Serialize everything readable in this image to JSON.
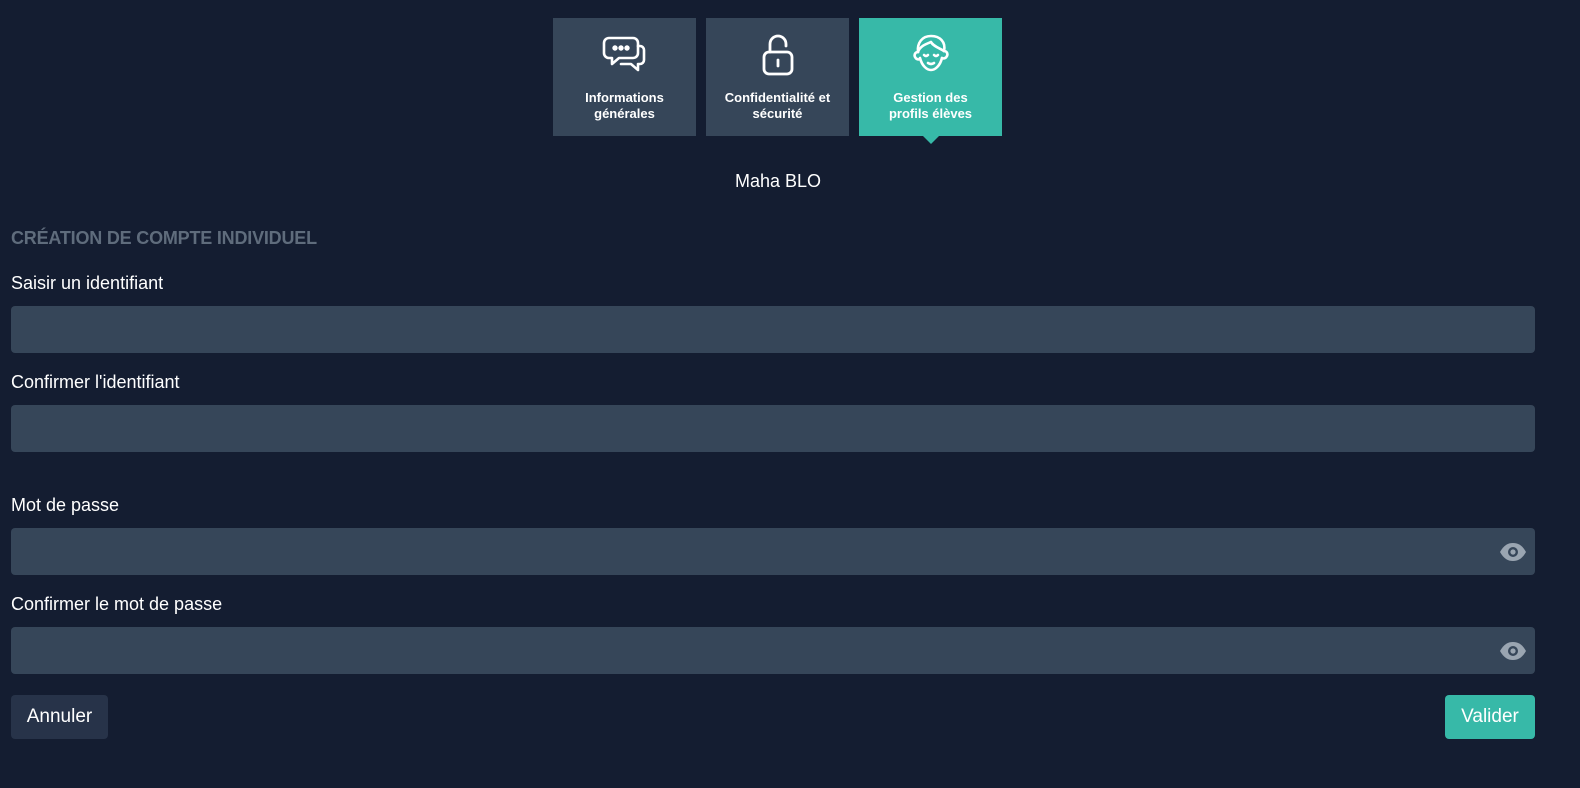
{
  "tabs": [
    {
      "label": "Informations\ngénérales",
      "icon": "chat-bubbles-icon",
      "active": false
    },
    {
      "label": "Confidentialité et\nsécurité",
      "icon": "unlock-padlock-icon",
      "active": false
    },
    {
      "label": "Gestion des\nprofils élèves",
      "icon": "student-face-icon",
      "active": true
    }
  ],
  "user_name": "Maha BLO",
  "form": {
    "section_title": "CRÉATION DE COMPTE INDIVIDUEL",
    "identifier_label": "Saisir un identifiant",
    "identifier_value": "",
    "confirm_identifier_label": "Confirmer l'identifiant",
    "confirm_identifier_value": "",
    "password_label": "Mot de passe",
    "password_value": "",
    "confirm_password_label": "Confirmer le mot de passe",
    "confirm_password_value": "",
    "eye_icon": "eye-icon"
  },
  "buttons": {
    "cancel_label": "Annuler",
    "submit_label": "Valider"
  },
  "colors": {
    "background": "#141d31",
    "panel": "#364659",
    "accent": "#37b9a8",
    "section_title": "#5f6c7c",
    "cancel_button": "#273349"
  }
}
